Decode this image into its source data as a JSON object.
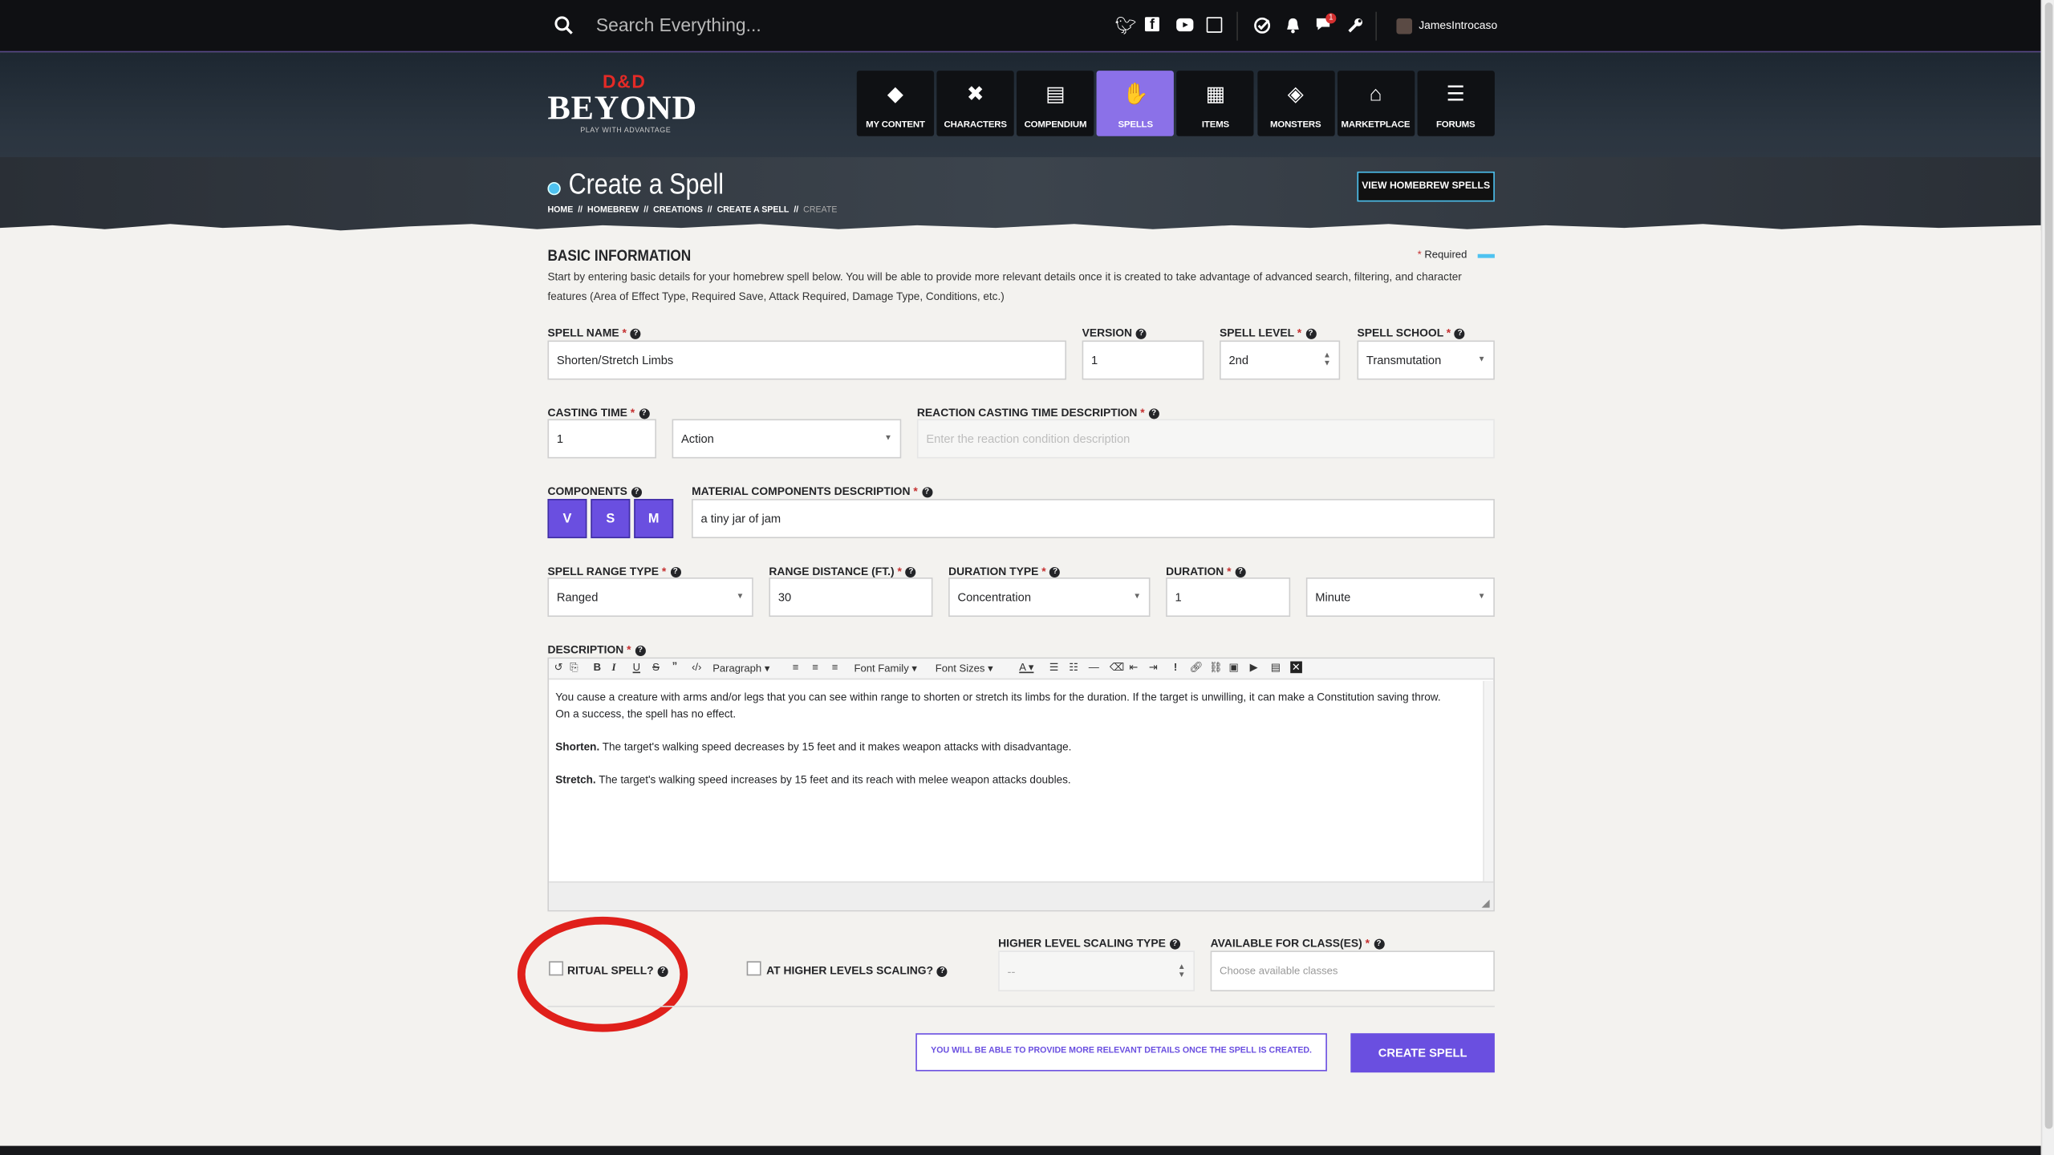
{
  "topbar": {
    "search_placeholder": "Search Everything...",
    "notification_count": "1",
    "username": "JamesIntrocaso",
    "icons": [
      "twitter-icon",
      "facebook-icon",
      "youtube-icon",
      "twitch-icon",
      "check-icon",
      "bell-icon",
      "chat-icon",
      "wrench-icon"
    ]
  },
  "brand": {
    "logo_top": "D&D",
    "logo": "BEYOND",
    "tagline": "PLAY WITH ADVANTAGE"
  },
  "nav": [
    {
      "label": "MY CONTENT",
      "icon": "◆"
    },
    {
      "label": "CHARACTERS",
      "icon": "✖"
    },
    {
      "label": "COMPENDIUM",
      "icon": "▤"
    },
    {
      "label": "SPELLS",
      "icon": "✋"
    },
    {
      "label": "ITEMS",
      "icon": "▦"
    },
    {
      "label": "MONSTERS",
      "icon": "◈"
    },
    {
      "label": "MARKETPLACE",
      "icon": "⌂"
    },
    {
      "label": "FORUMS",
      "icon": "☰"
    }
  ],
  "page": {
    "title": "Create a Spell",
    "view_homebrew": "VIEW HOMEBREW SPELLS",
    "breadcrumb": [
      "HOME",
      "HOMEBREW",
      "CREATIONS",
      "CREATE A SPELL",
      "CREATE"
    ],
    "sep": "//"
  },
  "basic": {
    "heading": "BASIC INFORMATION",
    "required": "Required",
    "intro_line1": "Start by entering basic details for your homebrew spell below. You will be able to provide more relevant details once it is created to take advantage of advanced search, filtering, and character",
    "intro_line2": "features (Area of Effect Type, Required Save, Attack Required, Damage Type, Conditions, etc.)"
  },
  "fields": {
    "spell_name": {
      "label": "SPELL NAME",
      "value": "Shorten/Stretch Limbs"
    },
    "version": {
      "label": "VERSION",
      "value": "1"
    },
    "spell_level": {
      "label": "SPELL LEVEL",
      "value": "2nd"
    },
    "spell_school": {
      "label": "SPELL SCHOOL",
      "value": "Transmutation"
    },
    "casting_time": {
      "label": "CASTING TIME",
      "value": "1",
      "unit": "Action"
    },
    "reaction_desc": {
      "label": "REACTION CASTING TIME DESCRIPTION",
      "placeholder": "Enter the reaction condition description"
    },
    "components": {
      "label": "COMPONENTS",
      "v": "V",
      "s": "S",
      "m": "M"
    },
    "material_desc": {
      "label": "MATERIAL COMPONENTS DESCRIPTION",
      "value": "a tiny jar of jam"
    },
    "range_type": {
      "label": "SPELL RANGE TYPE",
      "value": "Ranged"
    },
    "range_distance": {
      "label": "RANGE DISTANCE (FT.)",
      "value": "30"
    },
    "duration_type": {
      "label": "DURATION TYPE",
      "value": "Concentration"
    },
    "duration": {
      "label": "DURATION",
      "value": "1",
      "unit": "Minute"
    },
    "description": {
      "label": "DESCRIPTION",
      "toolbar": {
        "paragraph": "Paragraph",
        "font_family": "Font Family",
        "font_sizes": "Font Sizes"
      },
      "p1": "You cause a creature with arms and/or legs that you can see within range to shorten or stretch its limbs for the duration. If the target is unwilling, it can make a Constitution saving throw.",
      "p1b": "On a success, the spell has no effect.",
      "p2_bold": "Shorten.",
      "p2": " The target's walking speed decreases by 15 feet and it makes weapon attacks with disadvantage.",
      "p3_bold": "Stretch.",
      "p3": " The target's walking speed increases by 15 feet and its reach with melee weapon attacks doubles."
    },
    "ritual": {
      "label": "RITUAL SPELL?"
    },
    "higher_levels": {
      "label": "AT HIGHER LEVELS SCALING?"
    },
    "scaling_type": {
      "label": "HIGHER LEVEL SCALING TYPE",
      "value": "--"
    },
    "classes": {
      "label": "AVAILABLE FOR CLASS(ES)",
      "placeholder": "Choose available classes"
    }
  },
  "footer": {
    "notice": "YOU WILL BE ABLE TO PROVIDE MORE RELEVANT DETAILS ONCE THE SPELL IS CREATED.",
    "create": "CREATE SPELL"
  },
  "colors": {
    "accent": "#6a4fe0",
    "active_nav": "#8b71e8",
    "annotation": "#e0201b",
    "required_bar": "#4ec2f0"
  }
}
